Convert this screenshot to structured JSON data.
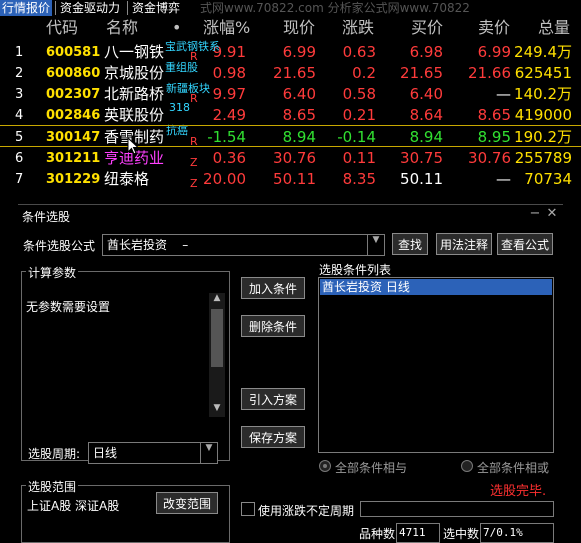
{
  "colors": {
    "up": "#ff3b3b",
    "down": "#31e031",
    "neutral": "#ffffff",
    "code": "#ffe000",
    "yellowVal": "#ffe000",
    "tag": "#33d6ff",
    "magenta": "#ff40ff",
    "highlight": "#2c62b8"
  },
  "tabs": [
    "行情报价",
    "资金驱动力",
    "资金博弈"
  ],
  "watermark": "式网www.70822.com      分析家公式网www.70822",
  "table": {
    "headers": {
      "code": "代码",
      "name": "名称",
      "dot": "•",
      "pct": "涨幅%",
      "price": "现价",
      "change": "涨跌",
      "bid": "买价",
      "ask": "卖价",
      "total": "总量"
    },
    "rows": [
      {
        "idx": "1",
        "code": "600581",
        "name": "八一钢铁",
        "tag": "宝武钢铁系",
        "tagColor": "cyan",
        "flag": "R",
        "pct": "9.91",
        "price": "6.99",
        "change": "0.63",
        "bid": "6.98",
        "ask": "6.99",
        "total": "249.4万",
        "color": "up",
        "totalColor": "yellow"
      },
      {
        "idx": "2",
        "code": "600860",
        "name": "京城股份",
        "tag": "重组股",
        "tagColor": "cyan",
        "flag": "",
        "pct": "0.98",
        "price": "21.65",
        "change": "0.2",
        "bid": "21.65",
        "ask": "21.66",
        "total": "625451",
        "color": "up",
        "totalColor": "yellow"
      },
      {
        "idx": "3",
        "code": "002307",
        "name": "北新路桥",
        "tag": "新疆板块",
        "tagColor": "cyan",
        "flag": "R",
        "pct": "9.97",
        "price": "6.40",
        "change": "0.58",
        "bid": "6.40",
        "ask": "—",
        "total": "140.2万",
        "color": "up",
        "totalColor": "yellow"
      },
      {
        "idx": "4",
        "code": "002846",
        "name": "英联股份",
        "tag": "318",
        "tagColor": "cyan",
        "flag": "",
        "pct": "2.49",
        "price": "8.65",
        "change": "0.21",
        "bid": "8.64",
        "ask": "8.65",
        "total": "419000",
        "color": "up",
        "totalColor": "yellow"
      },
      {
        "idx": "5",
        "code": "300147",
        "name": "香雪制药",
        "tag": "抗癌",
        "tagColor": "cyan",
        "flag": "R",
        "pct": "-1.54",
        "price": "8.94",
        "change": "-0.14",
        "bid": "8.94",
        "ask": "8.95",
        "total": "190.2万",
        "color": "down",
        "totalColor": "yellow"
      },
      {
        "idx": "6",
        "code": "301211",
        "name": "亨迪药业",
        "tag": "",
        "tagColor": "cyan",
        "flag": "Z",
        "pct": "0.36",
        "price": "30.76",
        "change": "0.11",
        "bid": "30.75",
        "ask": "30.76",
        "total": "255789",
        "color": "up",
        "totalColor": "yellow",
        "nameColor": "magenta"
      },
      {
        "idx": "7",
        "code": "301229",
        "name": "纽泰格",
        "tag": "",
        "tagColor": "cyan",
        "flag": "Z",
        "pct": "20.00",
        "price": "50.11",
        "change": "8.35",
        "bid": "50.11",
        "ask": "—",
        "total": "70734",
        "color": "up",
        "totalColor": "yellow"
      }
    ]
  },
  "dialog": {
    "title": "条件选股",
    "formula_label": "条件选股公式",
    "formula_value": "酋长岩投资    –",
    "btn_find": "查找",
    "btn_usage": "用法注释",
    "btn_view": "查看公式",
    "params_label": "计算参数",
    "params_text": "无参数需要设置",
    "period_label": "选股周期:",
    "period_value": "日线",
    "btn_add": "加入条件",
    "btn_delete": "删除条件",
    "btn_import": "引入方案",
    "btn_save": "保存方案",
    "list_label": "选股条件列表",
    "list_items": [
      "酋长岩投资    日线"
    ],
    "radio_and": "全部条件相与",
    "radio_or": "全部条件相或",
    "status": "选股完毕.",
    "range_label": "选股范围",
    "range_text": "上证A股  深证A股",
    "btn_range": "改变范围",
    "checkbox_label": "使用涨跌不定周期",
    "count_label": "品种数",
    "count_value": "4711",
    "selected_label": "选中数",
    "selected_value": "7/0.1%"
  }
}
